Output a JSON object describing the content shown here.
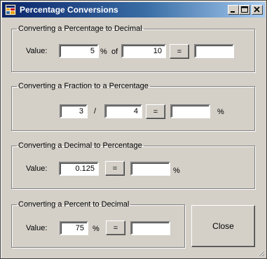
{
  "window": {
    "title": "Percentage Conversions"
  },
  "title_buttons": {
    "minimize_icon": "minimize-icon",
    "maximize_icon": "maximize-icon",
    "close_icon": "close-icon"
  },
  "group1": {
    "legend": "Converting a Percentage to Decimal",
    "value_label": "Value:",
    "percent_value": "5",
    "percent_sign": "%",
    "of_label": "of",
    "of_value": "10",
    "equals_label": "=",
    "result": ""
  },
  "group2": {
    "legend": "Converting a Fraction to a Percentage",
    "numerator": "3",
    "slash": "/",
    "denominator": "4",
    "equals_label": "=",
    "result": "",
    "percent_sign": "%"
  },
  "group3": {
    "legend": "Converting a Decimal to Percentage",
    "value_label": "Value:",
    "decimal_value": "0.125",
    "equals_label": "=",
    "result": "",
    "percent_sign": "%"
  },
  "group4": {
    "legend": "Converting a Percent to Decimal",
    "value_label": "Value:",
    "percent_value": "75",
    "percent_sign": "%",
    "equals_label": "=",
    "result": ""
  },
  "close_button": {
    "label": "Close"
  }
}
